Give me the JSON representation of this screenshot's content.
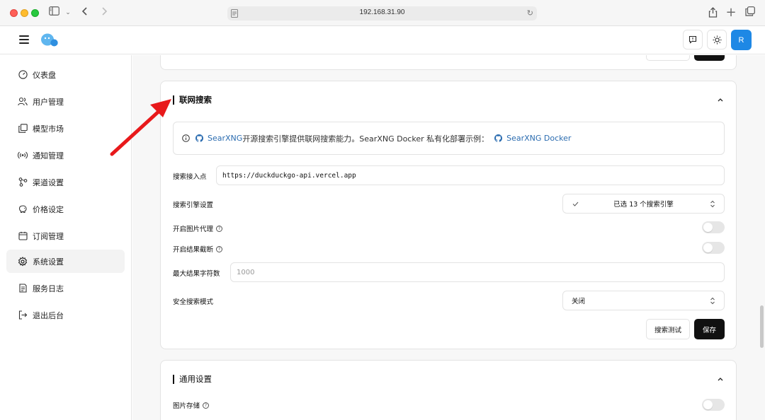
{
  "browser": {
    "url": "192.168.31.90"
  },
  "header": {
    "avatar_initial": "R"
  },
  "sidebar": {
    "items": [
      {
        "label": "仪表盘",
        "icon": "gauge-icon"
      },
      {
        "label": "用户管理",
        "icon": "users-icon"
      },
      {
        "label": "模型市场",
        "icon": "copy-icon"
      },
      {
        "label": "通知管理",
        "icon": "broadcast-icon"
      },
      {
        "label": "渠道设置",
        "icon": "share-icon"
      },
      {
        "label": "价格设定",
        "icon": "piggy-bank-icon"
      },
      {
        "label": "订阅管理",
        "icon": "calendar-icon"
      },
      {
        "label": "系统设置",
        "icon": "gear-icon",
        "active": true
      },
      {
        "label": "服务日志",
        "icon": "log-icon"
      },
      {
        "label": "退出后台",
        "icon": "logout-icon"
      }
    ]
  },
  "web_search": {
    "title": "联网搜索",
    "info": {
      "link1": "SearXNG",
      "text": " 开源搜索引擎提供联网搜索能力。SearXNG Docker 私有化部署示例：",
      "link2": "SearXNG Docker"
    },
    "endpoint": {
      "label": "搜索接入点",
      "value": "https://duckduckgo-api.vercel.app"
    },
    "engine": {
      "label": "搜索引擎设置",
      "value": "已选 13 个搜索引擎"
    },
    "image_proxy": {
      "label": "开启图片代理",
      "enabled": false
    },
    "truncate": {
      "label": "开启结果截断",
      "enabled": false
    },
    "max_chars": {
      "label": "最大结果字符数",
      "placeholder": "1000"
    },
    "safe_search": {
      "label": "安全搜索模式",
      "value": "关闭"
    },
    "buttons": {
      "test": "搜索测试",
      "save": "保存"
    }
  },
  "general": {
    "title": "通用设置",
    "image_storage": {
      "label": "图片存储",
      "enabled": false
    }
  },
  "colors": {
    "accent": "#1e88e5",
    "link": "#2b6cb0",
    "annotation_arrow": "#e8191b"
  }
}
